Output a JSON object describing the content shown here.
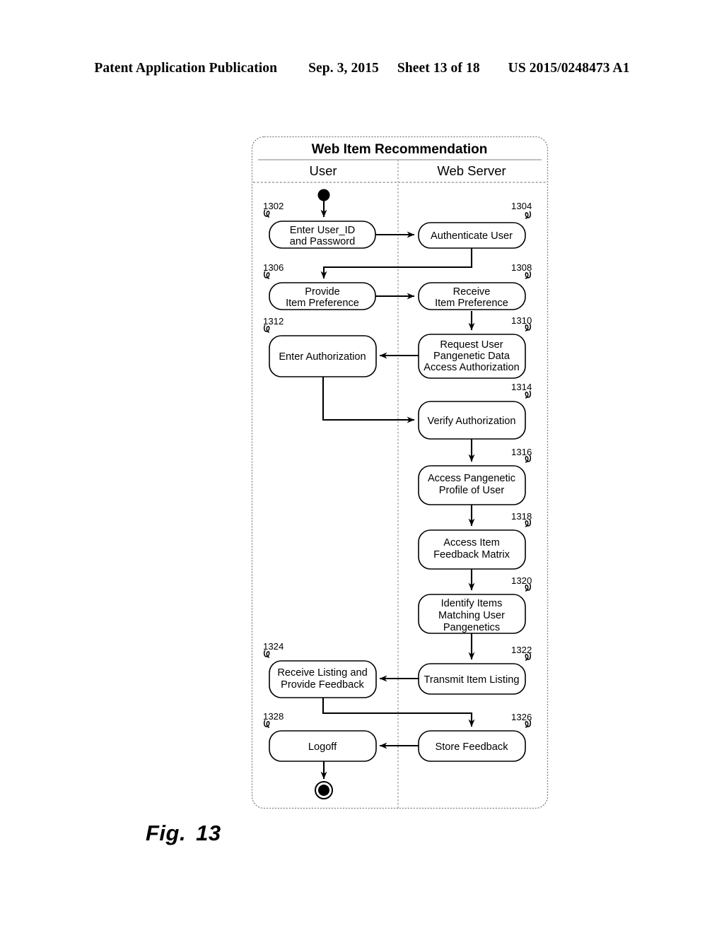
{
  "header": {
    "publication": "Patent Application Publication",
    "date": "Sep. 3, 2015",
    "sheet": "Sheet 13 of 18",
    "patent_number": "US 2015/0248473 A1"
  },
  "figure": {
    "label": "Fig.",
    "number": "13"
  },
  "diagram": {
    "title": "Web Item Recommendation",
    "lanes": [
      {
        "name": "User"
      },
      {
        "name": "Web Server"
      }
    ],
    "start_node": "start-node",
    "end_node": "end-node",
    "nodes": [
      {
        "ref": "1302",
        "lane": "User",
        "label": [
          "Enter User_ID",
          "and Password"
        ]
      },
      {
        "ref": "1304",
        "lane": "Web Server",
        "label": [
          "Authenticate User"
        ]
      },
      {
        "ref": "1306",
        "lane": "User",
        "label": [
          "Provide",
          "Item Preference"
        ]
      },
      {
        "ref": "1308",
        "lane": "Web Server",
        "label": [
          "Receive",
          "Item Preference"
        ]
      },
      {
        "ref": "1310",
        "lane": "Web Server",
        "label": [
          "Request User",
          "Pangenetic Data",
          "Access Authorization"
        ]
      },
      {
        "ref": "1312",
        "lane": "User",
        "label": [
          "Enter Authorization"
        ]
      },
      {
        "ref": "1314",
        "lane": "Web Server",
        "label": [
          "Verify Authorization"
        ]
      },
      {
        "ref": "1316",
        "lane": "Web Server",
        "label": [
          "Access Pangenetic",
          "Profile of User"
        ]
      },
      {
        "ref": "1318",
        "lane": "Web Server",
        "label": [
          "Access Item",
          "Feedback Matrix"
        ]
      },
      {
        "ref": "1320",
        "lane": "Web Server",
        "label": [
          "Identify Items",
          "Matching User",
          "Pangenetics"
        ]
      },
      {
        "ref": "1322",
        "lane": "Web Server",
        "label": [
          "Transmit Item Listing"
        ]
      },
      {
        "ref": "1324",
        "lane": "User",
        "label": [
          "Receive Listing and",
          "Provide Feedback"
        ]
      },
      {
        "ref": "1326",
        "lane": "Web Server",
        "label": [
          "Store Feedback"
        ]
      },
      {
        "ref": "1328",
        "lane": "User",
        "label": [
          "Logoff"
        ]
      }
    ],
    "flows": [
      {
        "from": "start",
        "to": "1302"
      },
      {
        "from": "1302",
        "to": "1304"
      },
      {
        "from": "1304",
        "to": "1306"
      },
      {
        "from": "1306",
        "to": "1308"
      },
      {
        "from": "1308",
        "to": "1310"
      },
      {
        "from": "1310",
        "to": "1312"
      },
      {
        "from": "1312",
        "to": "1314"
      },
      {
        "from": "1314",
        "to": "1316"
      },
      {
        "from": "1316",
        "to": "1318"
      },
      {
        "from": "1318",
        "to": "1320"
      },
      {
        "from": "1320",
        "to": "1322"
      },
      {
        "from": "1322",
        "to": "1324"
      },
      {
        "from": "1324",
        "to": "1326"
      },
      {
        "from": "1326",
        "to": "1328"
      },
      {
        "from": "1328",
        "to": "end"
      }
    ]
  }
}
